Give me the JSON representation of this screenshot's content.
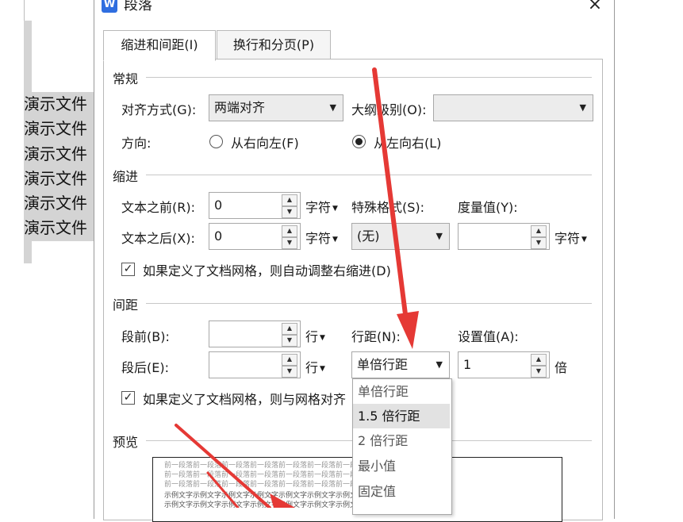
{
  "document": {
    "lines": [
      "演示文件",
      "演示文件",
      "演示文件",
      "演示文件",
      "演示文件",
      "演示文件"
    ]
  },
  "dialog": {
    "title": "段落",
    "logo": "W",
    "close": "×",
    "tabs": [
      "缩进和间距(I)",
      "换行和分页(P)"
    ],
    "general": {
      "section": "常规",
      "align_label": "对齐方式(G):",
      "align_value": "两端对齐",
      "outline_label": "大纲级别(O):",
      "outline_value": "",
      "direction_label": "方向:",
      "rtl_label": "从右向左(F)",
      "ltr_label": "从左向右(L)"
    },
    "indent": {
      "section": "缩进",
      "before_label": "文本之前(R):",
      "before_value": "0",
      "before_unit": "字符",
      "after_label": "文本之后(X):",
      "after_value": "0",
      "after_unit": "字符",
      "special_label": "特殊格式(S):",
      "special_value": "(无)",
      "measure_label": "度量值(Y):",
      "measure_value": "",
      "measure_unit": "字符",
      "grid_check": "如果定义了文档网格，则自动调整右缩进(D)"
    },
    "spacing": {
      "section": "间距",
      "before_label": "段前(B):",
      "before_value": "",
      "before_unit": "行",
      "after_label": "段后(E):",
      "after_value": "",
      "after_unit": "行",
      "line_label": "行距(N):",
      "line_value": "单倍行距",
      "set_label": "设置值(A):",
      "set_value": "1",
      "set_unit": "倍",
      "grid_check": "如果定义了文档网格，则与网格对齐"
    },
    "line_options": [
      "单倍行距",
      "1.5 倍行距",
      "2 倍行距",
      "最小值",
      "固定值"
    ],
    "preview": {
      "section": "预览",
      "text_gray": "前一段落前一段落前一段落前一段落前一段落前一段落前一段落前一段落前一段落",
      "text_dark": "示例文字示例文字示例文字示例文字示例文字示例文字示例文字示例文字示例文字示例文字"
    }
  },
  "colors": {
    "arrow": "#e53935",
    "accent": "#2f6ee0"
  },
  "icons": [
    "app-logo-icon",
    "close-icon",
    "spin-up-icon",
    "spin-down-icon",
    "dropdown-arrow-icon"
  ]
}
